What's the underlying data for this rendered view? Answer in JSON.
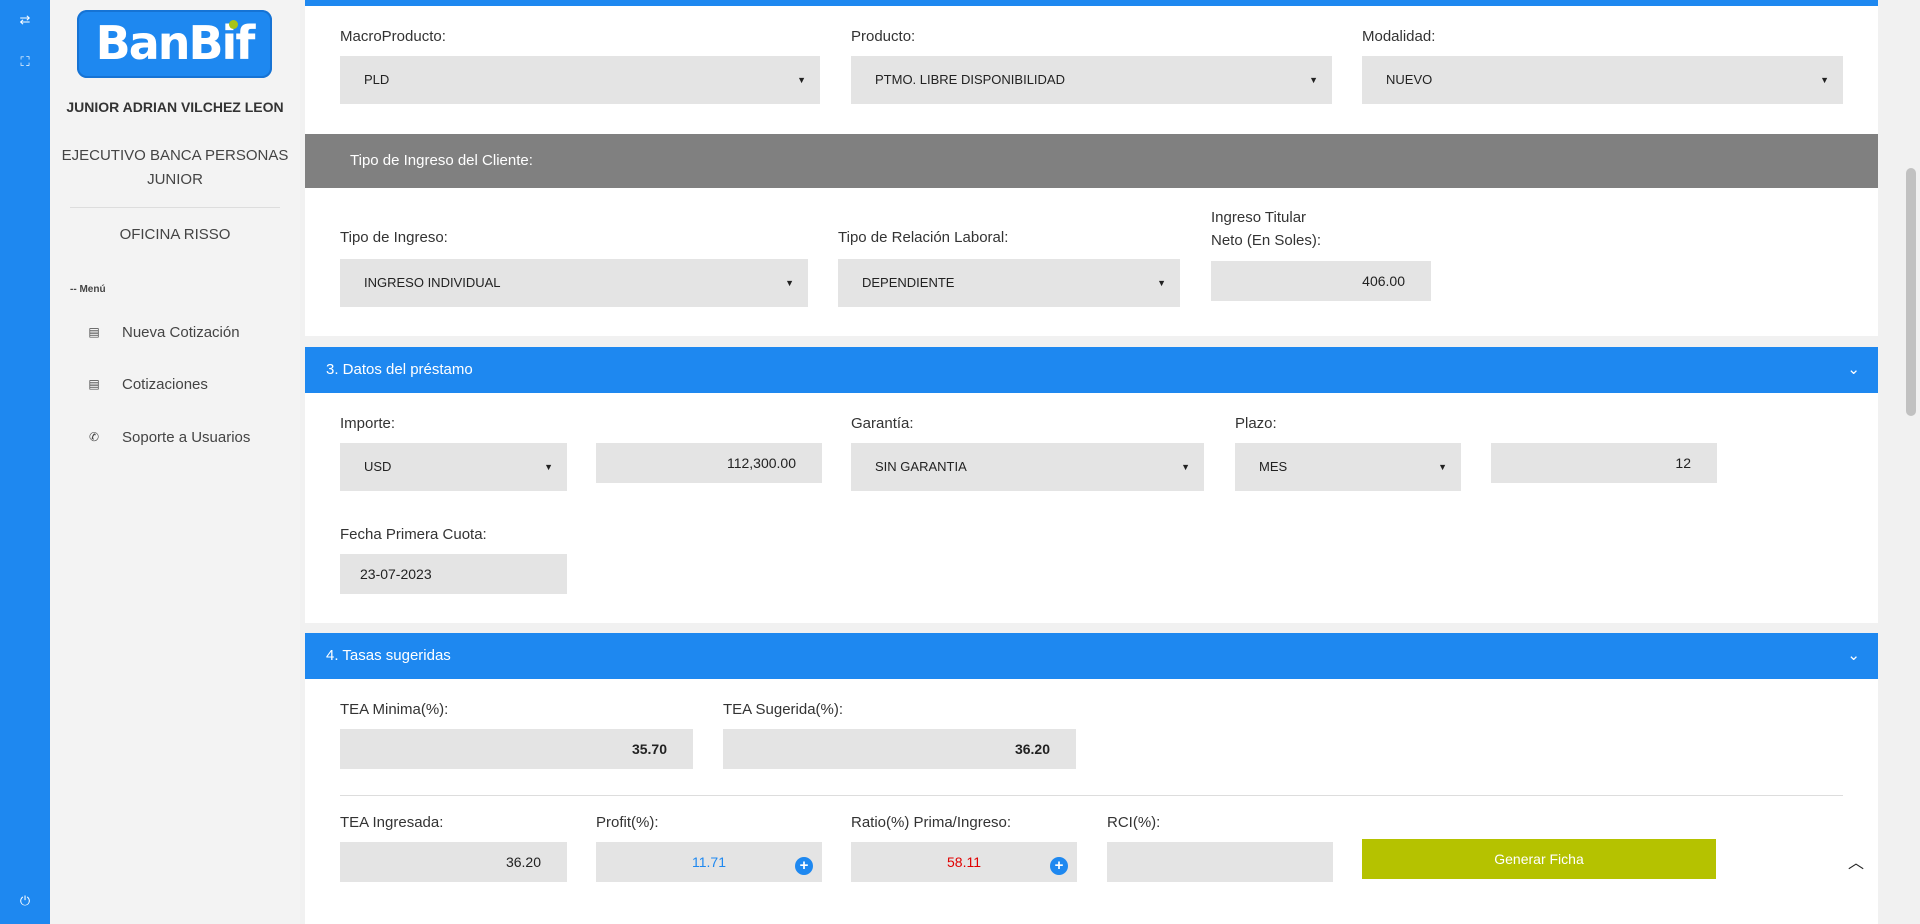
{
  "rail": {
    "icons": [
      "swap-icon",
      "fullscreen-icon",
      "power-icon"
    ]
  },
  "sidebar": {
    "logo_text": "BanBif",
    "user_name": "JUNIOR ADRIAN VILCHEZ LEON",
    "user_role": "EJECUTIVO BANCA PERSONAS JUNIOR",
    "office": "OFICINA RISSO",
    "menu_label": "-- Menú",
    "items": [
      {
        "label": "Nueva Cotización",
        "icon": "id-card-icon"
      },
      {
        "label": "Cotizaciones",
        "icon": "id-card-icon"
      },
      {
        "label": "Soporte a Usuarios",
        "icon": "phone-icon"
      }
    ]
  },
  "product": {
    "macro_label": "MacroProducto:",
    "macro_value": "PLD",
    "product_label": "Producto:",
    "product_value": "PTMO. LIBRE DISPONIBILIDAD",
    "modalidad_label": "Modalidad:",
    "modalidad_value": "NUEVO"
  },
  "ingreso": {
    "band_title": "Tipo de Ingreso del Cliente:",
    "tipo_label": "Tipo de Ingreso:",
    "tipo_value": "INGRESO INDIVIDUAL",
    "relacion_label": "Tipo de Relación Laboral:",
    "relacion_value": "DEPENDIENTE",
    "neto_label_1": "Ingreso Titular",
    "neto_label_2": "Neto (En Soles):",
    "neto_value": "406.00"
  },
  "prestamo": {
    "title": "3. Datos del préstamo",
    "importe_label": "Importe:",
    "moneda_value": "USD",
    "importe_value": "112,300.00",
    "garantia_label": "Garantía:",
    "garantia_value": "SIN GARANTIA",
    "plazo_label": "Plazo:",
    "plazo_unit_value": "MES",
    "plazo_value": "12",
    "fecha_label": "Fecha Primera Cuota:",
    "fecha_value": "23-07-2023"
  },
  "tasas": {
    "title": "4. Tasas sugeridas",
    "tea_min_label": "TEA Minima(%):",
    "tea_min_value": "35.70",
    "tea_sug_label": "TEA Sugerida(%):",
    "tea_sug_value": "36.20",
    "tea_ing_label": "TEA Ingresada:",
    "tea_ing_value": "36.20",
    "profit_label": "Profit(%):",
    "profit_value": "11.71",
    "ratio_label": "Ratio(%) Prima/Ingreso:",
    "ratio_value": "58.11",
    "rci_label": "RCI(%):",
    "rci_value": "",
    "generate_button": "Generar Ficha"
  },
  "colors": {
    "brand_blue": "#1e88f0",
    "band_grey": "#808080",
    "button_green": "#b5c200",
    "profit_blue": "#1e88f0",
    "ratio_red": "#e00000"
  }
}
